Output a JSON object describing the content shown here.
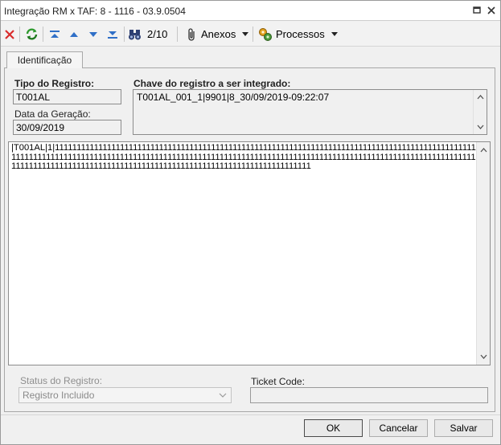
{
  "window": {
    "title": "Integração RM x TAF: 8 - 1116 - 03.9.0504"
  },
  "toolbar": {
    "record_position": "2/10",
    "anexos_label": "Anexos",
    "processos_label": "Processos"
  },
  "tabs": [
    {
      "label": "Identificação",
      "active": true
    }
  ],
  "form": {
    "tipo_registro_label": "Tipo do Registro:",
    "tipo_registro_value": "T001AL",
    "data_geracao_label": "Data da Geração:",
    "data_geracao_value": "30/09/2019",
    "chave_label": "Chave do registro a ser integrado:",
    "chave_value": "T001AL_001_1|9901|8_30/09/2019-09:22:07",
    "record_content": "|T001AL|1|111111111111111111111111111111111111111111111111111111111111111111111111111111111111111111111111111111111111111111111111111111111111111111111111111111111111111111111111111111111111111111111111111111111111111111111111111111111111111111111111111111111111111111111111111111111",
    "status_label": "Status do Registro:",
    "status_value": "Registro Incluido",
    "ticket_label": "Ticket Code:",
    "ticket_value": ""
  },
  "buttons": {
    "ok": "OK",
    "cancel": "Cancelar",
    "save": "Salvar"
  },
  "colors": {
    "accent_green": "#2e9a2e",
    "nav_blue": "#2f6fc7",
    "delete_red": "#d92b2b"
  }
}
